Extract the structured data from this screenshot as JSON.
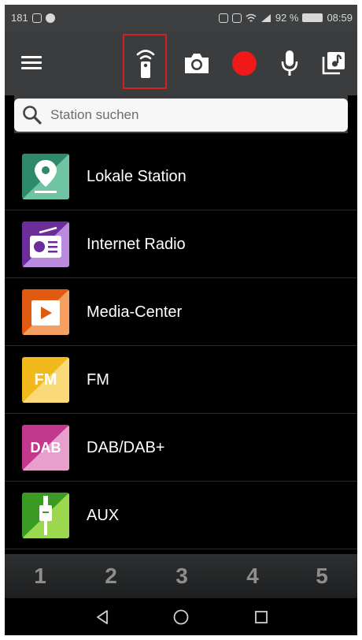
{
  "status_bar": {
    "left_text": "181",
    "battery_percent": "92 %",
    "time": "08:59"
  },
  "toolbar": {
    "menu_icon": "hamburger-menu-icon",
    "remote_icon": "remote-control-icon",
    "camera_icon": "camera-icon",
    "record_icon": "record-icon",
    "mic_icon": "microphone-icon",
    "music_icon": "music-library-icon",
    "highlight_color": "#d42020",
    "record_color": "#f01818"
  },
  "search": {
    "placeholder": "Station suchen"
  },
  "sources": [
    {
      "label": "Lokale Station",
      "icon": "location-pin-icon"
    },
    {
      "label": "Internet Radio",
      "icon": "radio-icon"
    },
    {
      "label": "Media-Center",
      "icon": "play-media-icon"
    },
    {
      "label": "FM",
      "icon": "fm-icon",
      "icon_text": "FM"
    },
    {
      "label": "DAB/DAB+",
      "icon": "dab-icon",
      "icon_text": "DAB"
    },
    {
      "label": "AUX",
      "icon": "aux-cable-icon"
    }
  ],
  "presets": [
    "1",
    "2",
    "3",
    "4",
    "5"
  ],
  "nav": {
    "back_icon": "back-triangle-icon",
    "home_icon": "home-circle-icon",
    "recents_icon": "recents-square-icon"
  }
}
